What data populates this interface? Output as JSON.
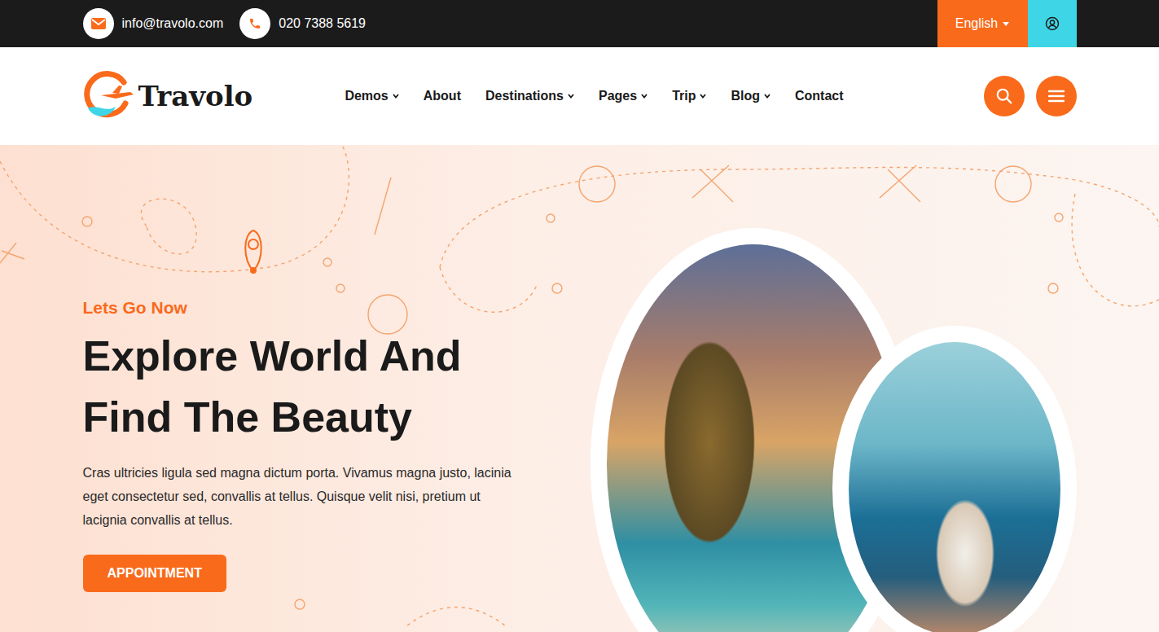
{
  "topbar": {
    "email": "info@travolo.com",
    "phone": "020 7388 5619",
    "language": "English"
  },
  "logo": {
    "text": "Travolo"
  },
  "nav": [
    {
      "label": "Demos",
      "dropdown": true
    },
    {
      "label": "About",
      "dropdown": false
    },
    {
      "label": "Destinations",
      "dropdown": true
    },
    {
      "label": "Pages",
      "dropdown": true
    },
    {
      "label": "Trip",
      "dropdown": true
    },
    {
      "label": "Blog",
      "dropdown": true
    },
    {
      "label": "Contact",
      "dropdown": false
    }
  ],
  "hero": {
    "eyebrow": "Lets Go Now",
    "title_lines": [
      "Explore World And",
      "Find The Beauty"
    ],
    "text": "Cras ultricies ligula sed magna dictum porta. Vivamus magna justo, lacinia eget consectetur sed, convallis at tellus. Quisque velit nisi, pretium ut lacignia convallis at tellus.",
    "button": "APPOINTMENT"
  }
}
